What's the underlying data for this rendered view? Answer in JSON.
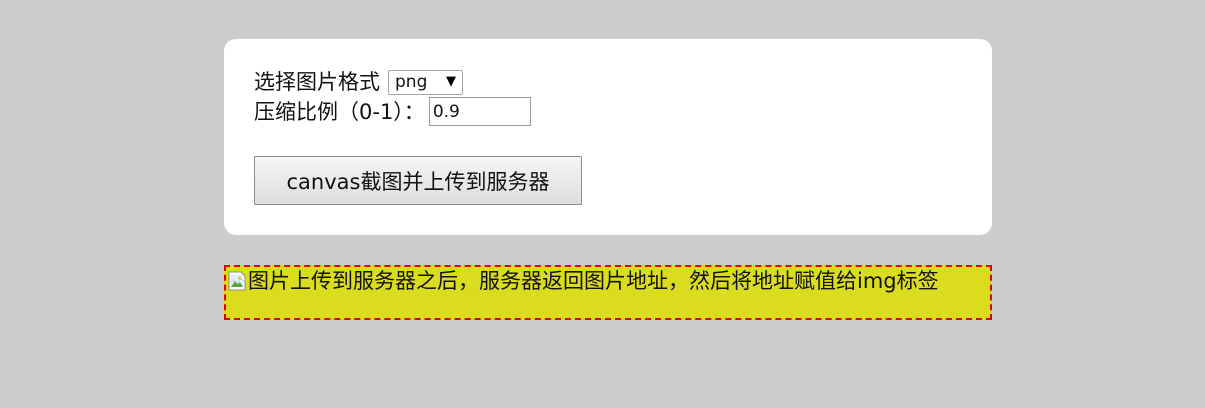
{
  "form": {
    "format_label": "选择图片格式",
    "format_value": "png",
    "ratio_label": "压缩比例（0-1）：",
    "ratio_value": "0.9"
  },
  "actions": {
    "upload_button": "canvas截图并上传到服务器"
  },
  "result": {
    "alt_text": "图片上传到服务器之后，服务器返回图片地址，然后将地址赋值给img标签",
    "icon": "broken-image-icon"
  },
  "colors": {
    "page_background": "#cccccc",
    "panel_background": "#ffffff",
    "result_background": "#dcdc1e",
    "result_border": "#e00000"
  }
}
